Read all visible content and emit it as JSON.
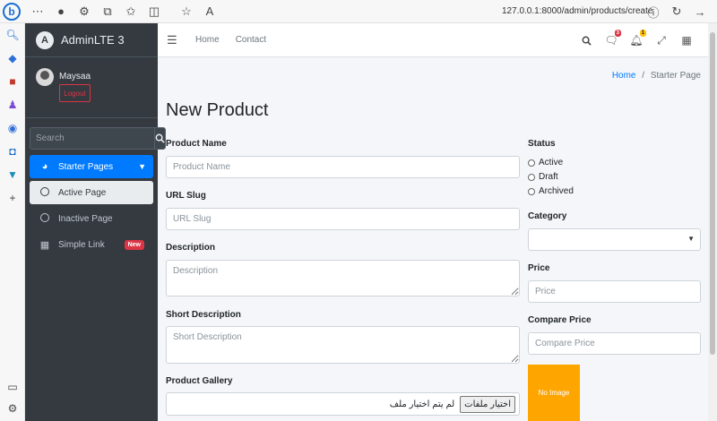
{
  "browser": {
    "url": "127.0.0.1:8000/admin/products/create",
    "logo_letter": "b"
  },
  "sidebar": {
    "brand": "AdminLTE 3",
    "brand_logo_letter": "A",
    "user_name": "Maysaa",
    "logout_label": "Logout",
    "search_placeholder": "Search",
    "items": [
      {
        "label": "Starter Pages"
      },
      {
        "label": "Active Page"
      },
      {
        "label": "Inactive Page"
      },
      {
        "label": "Simple Link",
        "badge": "New"
      }
    ]
  },
  "topnav": {
    "links": [
      "Home",
      "Contact"
    ],
    "messages_count": "3",
    "notifications_count": "1"
  },
  "breadcrumb": {
    "home": "Home",
    "separator": "/",
    "current": "Starter Page"
  },
  "page": {
    "title": "New Product"
  },
  "form": {
    "product_name": {
      "label": "Product Name",
      "placeholder": "Product Name"
    },
    "url_slug": {
      "label": "URL Slug",
      "placeholder": "URL Slug"
    },
    "description": {
      "label": "Description",
      "placeholder": "Description"
    },
    "short_description": {
      "label": "Short Description",
      "placeholder": "Short Description"
    },
    "product_gallery": {
      "label": "Product Gallery",
      "button": "اختيار ملفات",
      "status": "لم يتم اختيار ملف"
    },
    "status": {
      "label": "Status",
      "options": [
        "Active",
        "Draft",
        "Archived"
      ]
    },
    "category": {
      "label": "Category"
    },
    "price": {
      "label": "Price",
      "placeholder": "Price"
    },
    "compare_price": {
      "label": "Compare Price",
      "placeholder": "Compare Price"
    },
    "image_placeholder": "No Image"
  },
  "colors": {
    "primary": "#007bff",
    "sidebar_bg": "#343a40",
    "danger": "#dc3545",
    "no_image_bg": "#ffa500"
  }
}
